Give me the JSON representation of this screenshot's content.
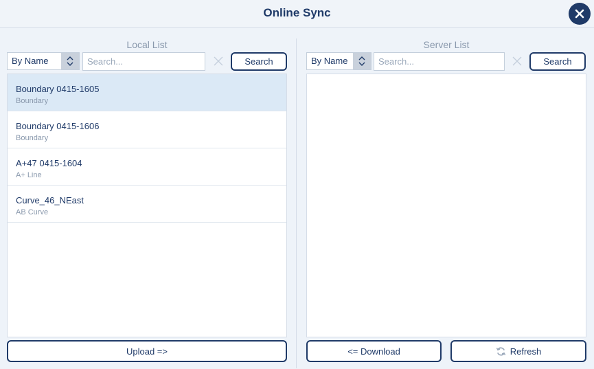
{
  "dialog": {
    "title": "Online Sync"
  },
  "local": {
    "title": "Local List",
    "sort_label": "By Name",
    "search_placeholder": "Search...",
    "search_button": "Search",
    "items": [
      {
        "name": "Boundary 0415-1605",
        "type": "Boundary",
        "selected": true
      },
      {
        "name": "Boundary 0415-1606",
        "type": "Boundary",
        "selected": false
      },
      {
        "name": "A+47 0415-1604",
        "type": "A+ Line",
        "selected": false
      },
      {
        "name": "Curve_46_NEast",
        "type": "AB Curve",
        "selected": false
      }
    ],
    "upload_button": "Upload =>"
  },
  "server": {
    "title": "Server List",
    "sort_label": "By Name",
    "search_placeholder": "Search...",
    "search_button": "Search",
    "items": [],
    "download_button": "<= Download",
    "refresh_button": "Refresh"
  }
}
